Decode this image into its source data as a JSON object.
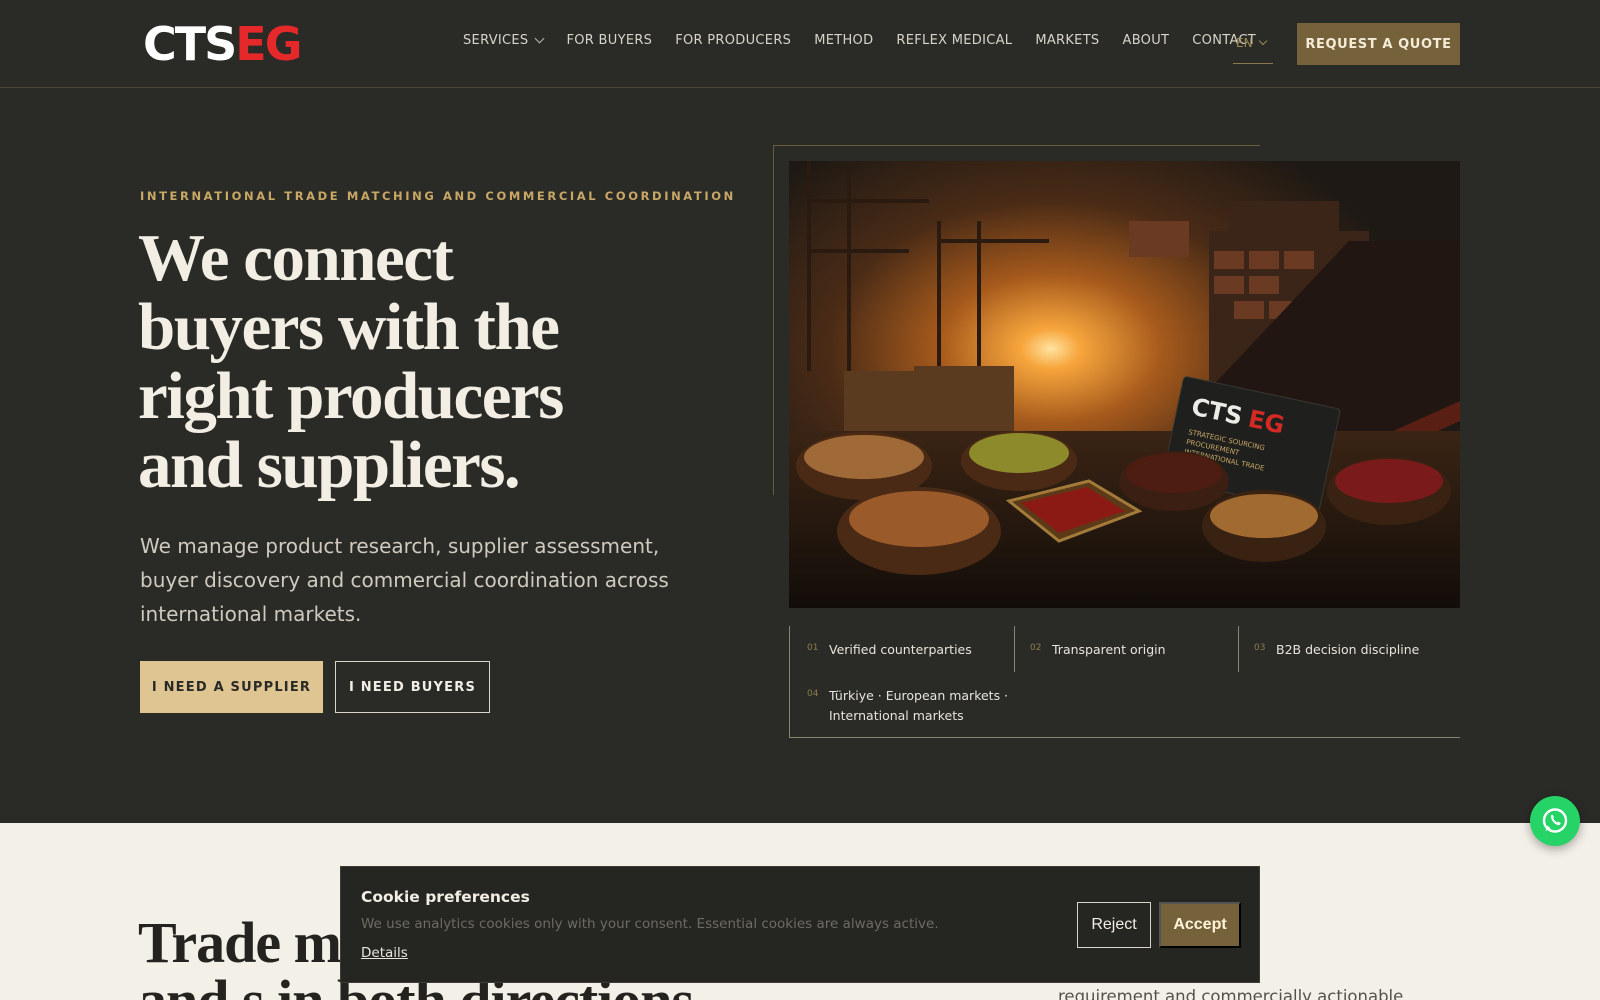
{
  "brand": {
    "logo_white": "CTS",
    "logo_red": "EG"
  },
  "nav": {
    "items": [
      "SERVICES",
      "FOR BUYERS",
      "FOR PRODUCERS",
      "METHOD",
      "REFLEX MEDICAL",
      "MARKETS",
      "ABOUT",
      "CONTACT"
    ],
    "language": "EN",
    "cta": "REQUEST A QUOTE"
  },
  "hero": {
    "eyebrow": "INTERNATIONAL TRADE MATCHING AND COMMERCIAL COORDINATION",
    "headline": [
      "We connect",
      "buyers with the",
      "right producers",
      "and suppliers."
    ],
    "lead": "We manage product research, supplier assessment, buyer discovery and commercial coordination across international markets.",
    "primary_button": "I NEED A SUPPLIER",
    "secondary_button": "I NEED BUYERS",
    "image_card": {
      "brand_white": "CTS",
      "brand_red": "EG",
      "tagline": [
        "STRATEGIC SOURCING",
        "PROCUREMENT",
        "INTERNATIONAL TRADE"
      ]
    }
  },
  "features": [
    {
      "num": "01",
      "label": "Verified counterparties"
    },
    {
      "num": "02",
      "label": "Transparent origin"
    },
    {
      "num": "03",
      "label": "B2B decision discipline"
    },
    {
      "num": "04",
      "label_lines": [
        "Türkiye · European markets ·",
        "International markets"
      ]
    }
  ],
  "lower": {
    "title_line1": "Trade mat",
    "title_line2": "and s in both directions",
    "text_line1": "ctured around a real",
    "text_line2": "requirement and commercially actionable"
  },
  "cookie": {
    "title": "Cookie preferences",
    "text": "We use analytics cookies only with your consent. Essential cookies are always active.",
    "details": "Details",
    "reject": "Reject",
    "accept": "Accept"
  },
  "colors": {
    "background": "#2a2a27",
    "accent_gold": "#c9a865",
    "button_gold": "#75613a",
    "button_light": "#dfc591",
    "logo_red": "#e5282a",
    "whatsapp": "#25d366"
  },
  "icons": [
    "chevron-down-icon",
    "whatsapp-icon"
  ]
}
